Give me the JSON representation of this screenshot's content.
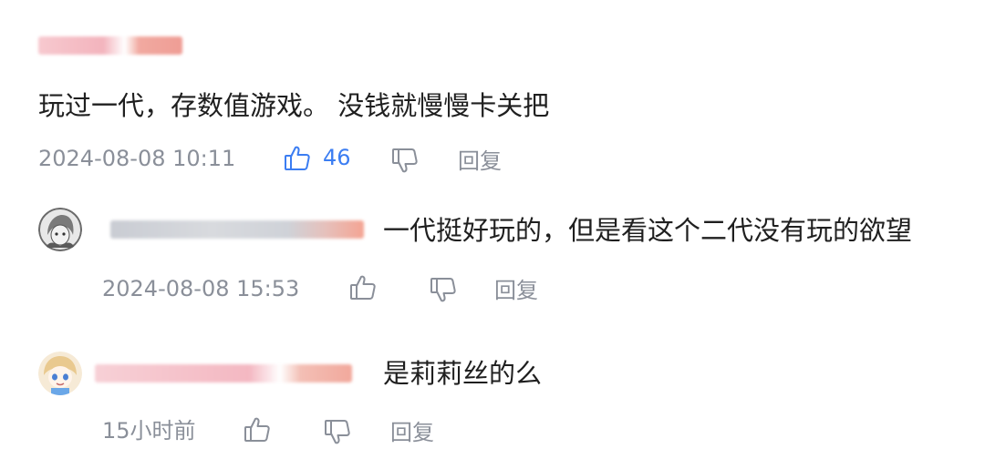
{
  "main_comment": {
    "text": "玩过一代，存数值游戏。 没钱就慢慢卡关把",
    "timestamp": "2024-08-08 10:11",
    "like_count": "46",
    "reply_label": "回复",
    "like_icon": "thumbs-up-icon",
    "dislike_icon": "thumbs-down-icon",
    "accent_color": "#3b7df2"
  },
  "replies": [
    {
      "text": "一代挺好玩的，但是看这个二代没有玩的欲望",
      "timestamp": "2024-08-08 15:53",
      "reply_label": "回复",
      "avatar_icon": "anime-avatar-icon"
    },
    {
      "text": "是莉莉丝的么",
      "timestamp": "15小时前",
      "reply_label": "回复",
      "avatar_icon": "anime-avatar-icon"
    }
  ]
}
